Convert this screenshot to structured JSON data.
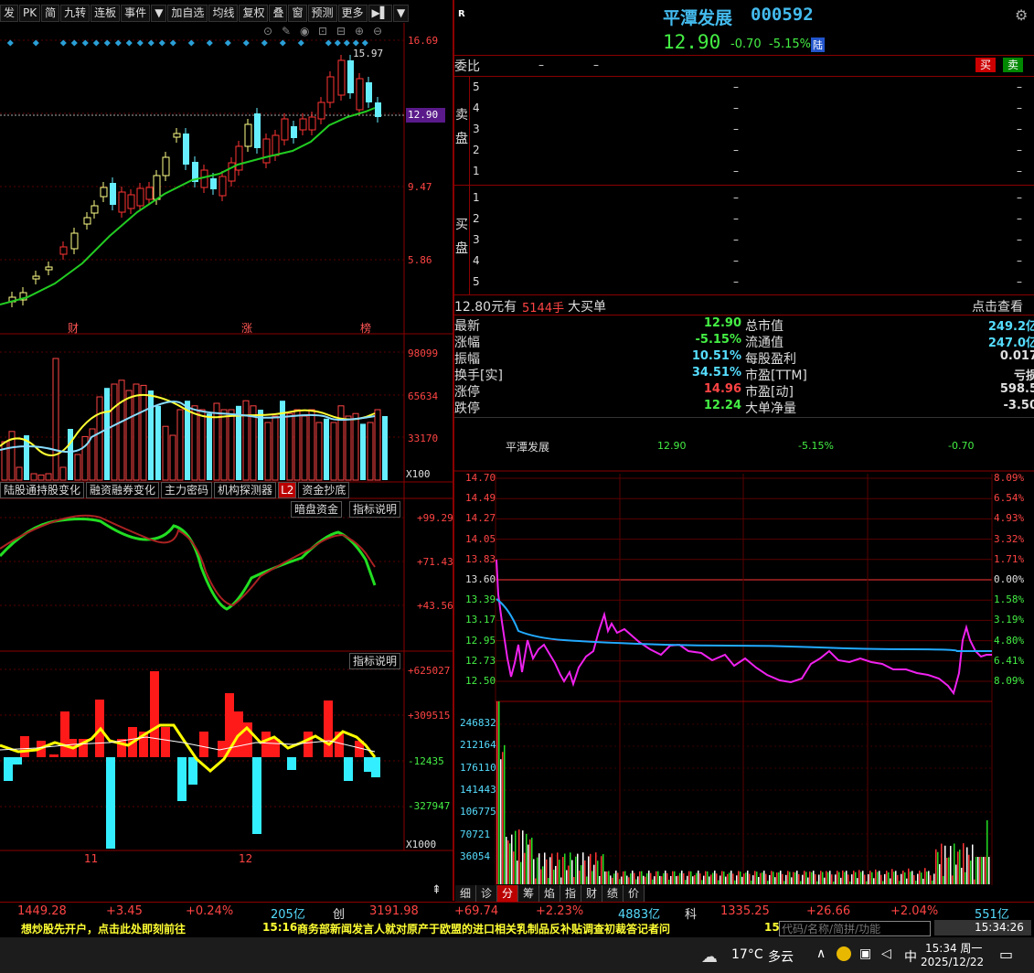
{
  "menu": [
    "发",
    "PK",
    "简",
    "九转",
    "连板",
    "事件",
    "▼",
    "加自选",
    "均线",
    "复权",
    "叠",
    "窗",
    "预测",
    "更多",
    "▶▌",
    "▼"
  ],
  "kline": {
    "price_axis": [
      "16.69",
      "12.90",
      "9.47",
      "5.86"
    ],
    "high_label": "15.97",
    "current_tag": "12.90",
    "markers": [
      "财",
      "涨",
      "榜"
    ]
  },
  "volume": {
    "axis": [
      "98099",
      "65634",
      "33170"
    ],
    "unit": "X100"
  },
  "tabs": [
    "陆股通持股变化",
    "融资融券变化",
    "主力密码",
    "机构探测器",
    "L2",
    "资金抄底"
  ],
  "ind1": {
    "buttons": [
      "暗盘资金",
      "指标说明"
    ],
    "axis": [
      "+99.29",
      "+71.43",
      "+43.56"
    ]
  },
  "ind2": {
    "button": "指标说明",
    "axis": [
      "+625027",
      "+309515",
      "-12435",
      "-327947"
    ],
    "unit": "X1000",
    "months": [
      "11",
      "12"
    ]
  },
  "quote": {
    "r": "R",
    "name": "平潭发展",
    "code": "000592",
    "price": "12.90",
    "change": "-0.70",
    "pct": "-5.15%",
    "tag": "陆",
    "weibi": "委比",
    "dash": "–",
    "buy": "买",
    "sell": "卖",
    "sell_label": "卖\n盘",
    "buy_label": "买\n盘",
    "levels": [
      "5",
      "4",
      "3",
      "2",
      "1"
    ],
    "levels_buy": [
      "1",
      "2",
      "3",
      "4",
      "5"
    ],
    "bigorder_price": "12.80元有",
    "bigorder_qty": "5144手",
    "bigorder_txt": "大买单",
    "bigorder_link": "点击查看"
  },
  "stats": [
    {
      "l": "最新",
      "v": "12.90",
      "vc": "green",
      "l2": "总市值",
      "v2": "249.2亿",
      "v2c": "cyan"
    },
    {
      "l": "涨幅",
      "v": "-5.15%",
      "vc": "green",
      "l2": "流通值",
      "v2": "247.0亿",
      "v2c": "cyan"
    },
    {
      "l": "振幅",
      "v": "10.51%",
      "vc": "cyan",
      "l2": "每股盈利",
      "v2": "0.017",
      "v2c": "white"
    },
    {
      "l": "换手[实]",
      "v": "34.51%",
      "vc": "cyan",
      "l2": "市盈[TTM]",
      "v2": "亏损",
      "v2c": "white"
    },
    {
      "l": "涨停",
      "v": "14.96",
      "vc": "red",
      "l2": "市盈[动]",
      "v2": "598.5",
      "v2c": "white"
    },
    {
      "l": "跌停",
      "v": "12.24",
      "vc": "green",
      "l2": "大单净量",
      "v2": "-3.50",
      "v2c": "white"
    }
  ],
  "intraday": {
    "header": [
      "平潭发展",
      "12.90",
      "-5.15%",
      "-0.70"
    ],
    "price_axis": [
      "14.70",
      "14.49",
      "14.27",
      "14.05",
      "13.83",
      "13.60",
      "13.39",
      "13.17",
      "12.95",
      "12.73",
      "12.50"
    ],
    "pct_axis": [
      "8.09%",
      "6.54%",
      "4.93%",
      "3.32%",
      "1.71%",
      "0.00%",
      "1.58%",
      "3.19%",
      "4.80%",
      "6.41%",
      "8.09%"
    ],
    "vol_axis": [
      "246832",
      "212164",
      "176110",
      "141443",
      "106775",
      "70721",
      "36054"
    ]
  },
  "bottom_tabs": [
    "细",
    "诊",
    "分",
    "筹",
    "焰",
    "指",
    "财",
    "绩",
    "价"
  ],
  "status": [
    {
      "t": "1449.28",
      "c": "red"
    },
    {
      "t": "+3.45",
      "c": "red"
    },
    {
      "t": "+0.24%",
      "c": "red"
    },
    {
      "t": "205亿",
      "c": "cyan"
    },
    {
      "t": "创",
      "c": "white"
    },
    {
      "t": "3191.98",
      "c": "red"
    },
    {
      "t": "+69.74",
      "c": "red"
    },
    {
      "t": "+2.23%",
      "c": "red"
    },
    {
      "t": "4883亿",
      "c": "cyan"
    },
    {
      "t": "科",
      "c": "white"
    },
    {
      "t": "1335.25",
      "c": "red"
    },
    {
      "t": "+26.66",
      "c": "red"
    },
    {
      "t": "+2.04%",
      "c": "red"
    },
    {
      "t": "551亿",
      "c": "cyan"
    }
  ],
  "ticker": {
    "left": "想炒股先开户，点击此处即刻前往",
    "time": "15:16",
    "news": "商务部新闻发言人就对原产于欧盟的进口相关乳制品反补贴调查初裁答记者问",
    "search": "代码/名称/简拼/功能",
    "clock": "15:34:26",
    "pre": "15"
  },
  "taskbar": {
    "temp": "17°C",
    "weather": "多云",
    "ime": "中",
    "time": "15:34 周一",
    "date": "2025/12/22"
  }
}
